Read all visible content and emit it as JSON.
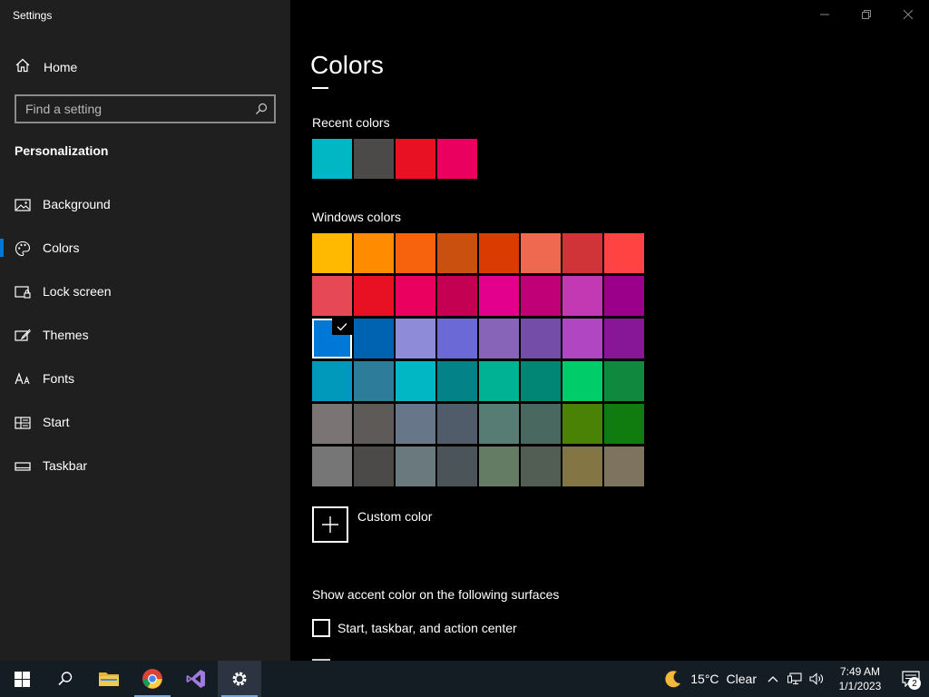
{
  "app": {
    "title": "Settings"
  },
  "sidebar": {
    "home_label": "Home",
    "search": {
      "placeholder": "Find a setting",
      "value": ""
    },
    "section": "Personalization",
    "items": [
      {
        "label": "Background",
        "icon": "picture-icon",
        "active": false
      },
      {
        "label": "Colors",
        "icon": "palette-icon",
        "active": true
      },
      {
        "label": "Lock screen",
        "icon": "lock-screen-icon",
        "active": false
      },
      {
        "label": "Themes",
        "icon": "themes-icon",
        "active": false
      },
      {
        "label": "Fonts",
        "icon": "fonts-icon",
        "active": false
      },
      {
        "label": "Start",
        "icon": "start-icon",
        "active": false
      },
      {
        "label": "Taskbar",
        "icon": "taskbar-icon",
        "active": false
      }
    ]
  },
  "main": {
    "title": "Colors",
    "recent_label": "Recent colors",
    "recent_colors": [
      "#00b7c3",
      "#4c4a48",
      "#e81123",
      "#ea005e"
    ],
    "windows_label": "Windows colors",
    "windows_colors": [
      [
        "#ffb900",
        "#ff8c00",
        "#f7630c",
        "#ca5010",
        "#da3b01",
        "#ef6950",
        "#d13438",
        "#ff4343"
      ],
      [
        "#e74856",
        "#e81123",
        "#ea005e",
        "#c30052",
        "#e3008c",
        "#bf0077",
        "#c239b3",
        "#9a0089"
      ],
      [
        "#0078d7",
        "#0063b1",
        "#8e8cd8",
        "#6b69d6",
        "#8764b8",
        "#744da9",
        "#b146c2",
        "#881798"
      ],
      [
        "#0099bc",
        "#2d7d9a",
        "#00b7c3",
        "#038387",
        "#00b294",
        "#018574",
        "#00cc6a",
        "#10893e"
      ],
      [
        "#7a7574",
        "#5d5a58",
        "#68768a",
        "#515c6b",
        "#567c73",
        "#486860",
        "#498205",
        "#107c10"
      ],
      [
        "#767676",
        "#4c4a48",
        "#69797e",
        "#4a5459",
        "#647c64",
        "#525e54",
        "#847545",
        "#7e735f"
      ]
    ],
    "selected_color": "#0078d7",
    "custom_color_label": "Custom color",
    "surfaces_label": "Show accent color on the following surfaces",
    "checkbox_start_label": "Start, taskbar, and action center"
  },
  "taskbar": {
    "weather": {
      "temp": "15°C",
      "condition": "Clear"
    },
    "clock": {
      "time": "7:49 AM",
      "date": "1/1/2023"
    },
    "notification_count": "2"
  },
  "colors": {
    "accent": "#0078d7",
    "sidebar_bg": "#1f1f1f",
    "taskbar_bg": "#141c24"
  }
}
